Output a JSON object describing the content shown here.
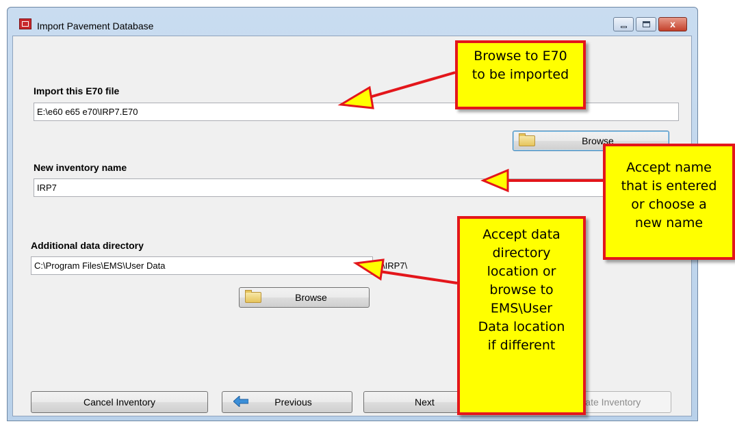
{
  "window": {
    "title": "Import Pavement Database",
    "close_glyph": "x"
  },
  "form": {
    "e70_label": "Import this E70 file",
    "e70_value": "E:\\e60 e65 e70\\IRP7.E70",
    "browse1_label": "Browse",
    "inventory_label": "New inventory name",
    "inventory_value": "IRP7",
    "datadir_label": "Additional data directory",
    "datadir_value": "C:\\Program Files\\EMS\\User Data",
    "datadir_suffix": "\\IRP7\\",
    "browse2_label": "Browse"
  },
  "footer": {
    "cancel_label": "Cancel Inventory",
    "previous_label": "Previous",
    "next_label": "Next",
    "create_label": "Create Inventory"
  },
  "annotations": {
    "browse_callout": [
      "Browse to E70",
      "to be imported"
    ],
    "name_callout": [
      "Accept name",
      "that is entered",
      "or choose a",
      "new name"
    ],
    "dir_callout": [
      "Accept data",
      "directory",
      "location or",
      "browse to",
      "EMS\\User",
      "Data location",
      "if different"
    ]
  },
  "colors": {
    "callout_fill": "#ffff00",
    "callout_border": "#e3161b",
    "arrow": "#e3161b"
  },
  "icons": {
    "app": "app-icon",
    "folder": "folder-icon",
    "previous": "arrow-left-icon",
    "create": "database-icon"
  }
}
